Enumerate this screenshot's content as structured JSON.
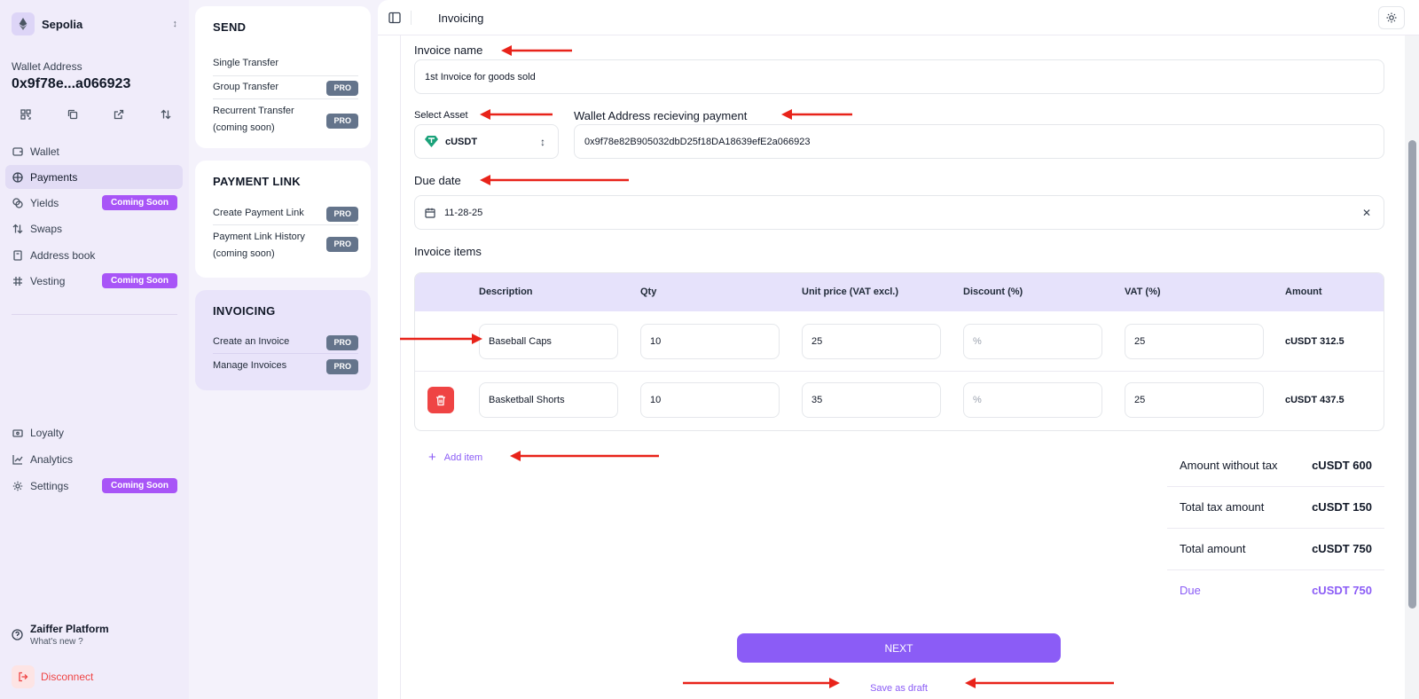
{
  "sidebar": {
    "network": "Sepolia",
    "wallet_label": "Wallet Address",
    "wallet_address": "0x9f78e...a066923",
    "nav": [
      {
        "label": "Wallet",
        "badge": ""
      },
      {
        "label": "Payments",
        "badge": ""
      },
      {
        "label": "Yields",
        "badge": "Coming Soon"
      },
      {
        "label": "Swaps",
        "badge": ""
      },
      {
        "label": "Address book",
        "badge": ""
      },
      {
        "label": "Vesting",
        "badge": "Coming Soon"
      }
    ],
    "nav_bottom": [
      {
        "label": "Loyalty",
        "badge": ""
      },
      {
        "label": "Analytics",
        "badge": ""
      },
      {
        "label": "Settings",
        "badge": "Coming Soon"
      }
    ],
    "platform_title": "Zaiffer Platform",
    "platform_sub": "What's new ?",
    "disconnect": "Disconnect"
  },
  "menu": {
    "send": {
      "title": "SEND",
      "items": [
        {
          "label": "Single Transfer",
          "badge": ""
        },
        {
          "label": "Group Transfer",
          "badge": "PRO"
        },
        {
          "label": "Recurrent Transfer",
          "label2": "(coming soon)",
          "badge": "PRO"
        }
      ]
    },
    "payment_link": {
      "title": "PAYMENT LINK",
      "items": [
        {
          "label": "Create Payment Link",
          "badge": "PRO"
        },
        {
          "label": "Payment Link History",
          "label2": "(coming soon)",
          "badge": "PRO"
        }
      ]
    },
    "invoicing": {
      "title": "INVOICING",
      "items": [
        {
          "label": "Create an Invoice",
          "badge": "PRO"
        },
        {
          "label": "Manage Invoices",
          "badge": "PRO"
        }
      ]
    }
  },
  "topbar": {
    "title": "Invoicing"
  },
  "form": {
    "invoice_name_label": "Invoice name",
    "invoice_name_value": "1st Invoice for goods sold",
    "asset_label": "Select Asset",
    "asset_value": "cUSDT",
    "wallet_label": "Wallet Address recieving payment",
    "wallet_value": "0x9f78e82B905032dbD25f18DA18639efE2a066923",
    "due_label": "Due date",
    "due_value": "11-28-25",
    "items_label": "Invoice items"
  },
  "table": {
    "headers": [
      "Description",
      "Qty",
      "Unit price (VAT excl.)",
      "Discount (%)",
      "VAT (%)",
      "Amount"
    ],
    "rows": [
      {
        "description": "Baseball Caps",
        "qty": "10",
        "unit_price": "25",
        "discount_placeholder": "%",
        "vat": "25",
        "amount": "cUSDT 312.5"
      },
      {
        "description": "Basketball Shorts",
        "qty": "10",
        "unit_price": "35",
        "discount_placeholder": "%",
        "vat": "25",
        "amount": "cUSDT 437.5"
      }
    ]
  },
  "add_item": "Add item",
  "totals": {
    "without_tax_label": "Amount without tax",
    "without_tax_value": "cUSDT 600",
    "tax_label": "Total tax amount",
    "tax_value": "cUSDT 150",
    "total_label": "Total amount",
    "total_value": "cUSDT 750",
    "due_label": "Due",
    "due_value": "cUSDT 750"
  },
  "actions": {
    "next": "NEXT",
    "draft": "Save as draft"
  },
  "colors": {
    "accent": "#8b5cf6",
    "badge": "#a855f7",
    "pro": "#64748b",
    "danger": "#ef4444",
    "annotation_arrow": "#e8231a"
  }
}
